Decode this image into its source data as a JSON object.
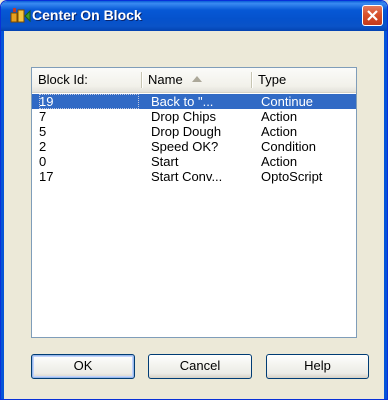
{
  "window": {
    "title": "Center On Block"
  },
  "list": {
    "columns": {
      "block_id": "Block Id:",
      "name": "Name",
      "type": "Type"
    },
    "sorted_by": "name",
    "sort_direction": "ascending",
    "rows": [
      {
        "id": "19",
        "name": "Back to \"...",
        "type": "Continue",
        "selected": true
      },
      {
        "id": "7",
        "name": "Drop Chips",
        "type": "Action",
        "selected": false
      },
      {
        "id": "5",
        "name": "Drop Dough",
        "type": "Action",
        "selected": false
      },
      {
        "id": "2",
        "name": "Speed OK?",
        "type": "Condition",
        "selected": false
      },
      {
        "id": "0",
        "name": "Start",
        "type": "Action",
        "selected": false
      },
      {
        "id": "17",
        "name": "Start Conv...",
        "type": "OptoScript",
        "selected": false
      }
    ]
  },
  "buttons": {
    "ok": "OK",
    "cancel": "Cancel",
    "help": "Help"
  },
  "colors": {
    "titlebar": "#0552cc",
    "selection": "#316ac5",
    "close": "#d8512b",
    "dialog_bg": "#ece9d8"
  },
  "icons": {
    "title": "flowchart-block-icon",
    "close": "close-icon",
    "sort": "sort-ascending-icon"
  }
}
